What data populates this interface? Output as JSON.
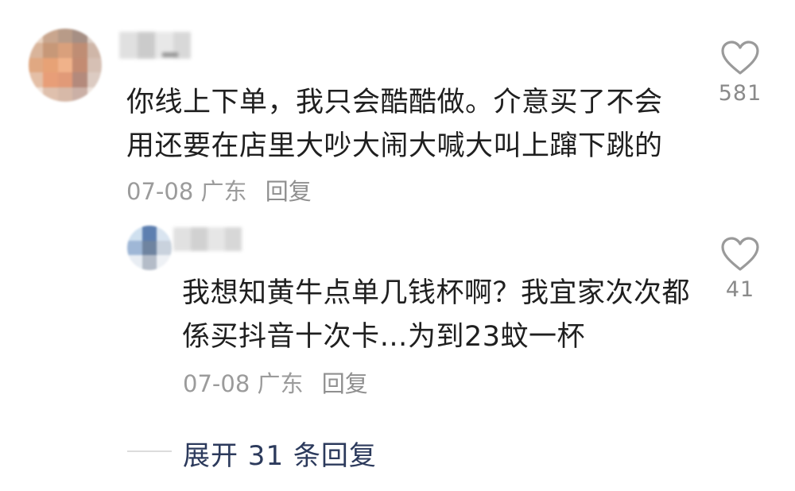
{
  "comment": {
    "text": "你线上下单，我只会酷酷做。介意买了不会用还要在店里大吵大闹大喊大叫上蹿下跳的",
    "date": "07-08",
    "location": "广东",
    "reply_label": "回复",
    "like_count": "581"
  },
  "reply": {
    "text": "我想知黄牛点单几钱杯啊？我宜家次次都係买抖音十次卡…为到23蚊一杯",
    "date": "07-08",
    "location": "广东",
    "reply_label": "回复",
    "like_count": "41"
  },
  "expand": {
    "label": "展开 31 条回复"
  },
  "colors": {
    "text": "#1f1f1f",
    "meta": "#9b9b9b",
    "link": "#2c3a5c"
  },
  "icons": {
    "like": "heart-outline-icon"
  }
}
